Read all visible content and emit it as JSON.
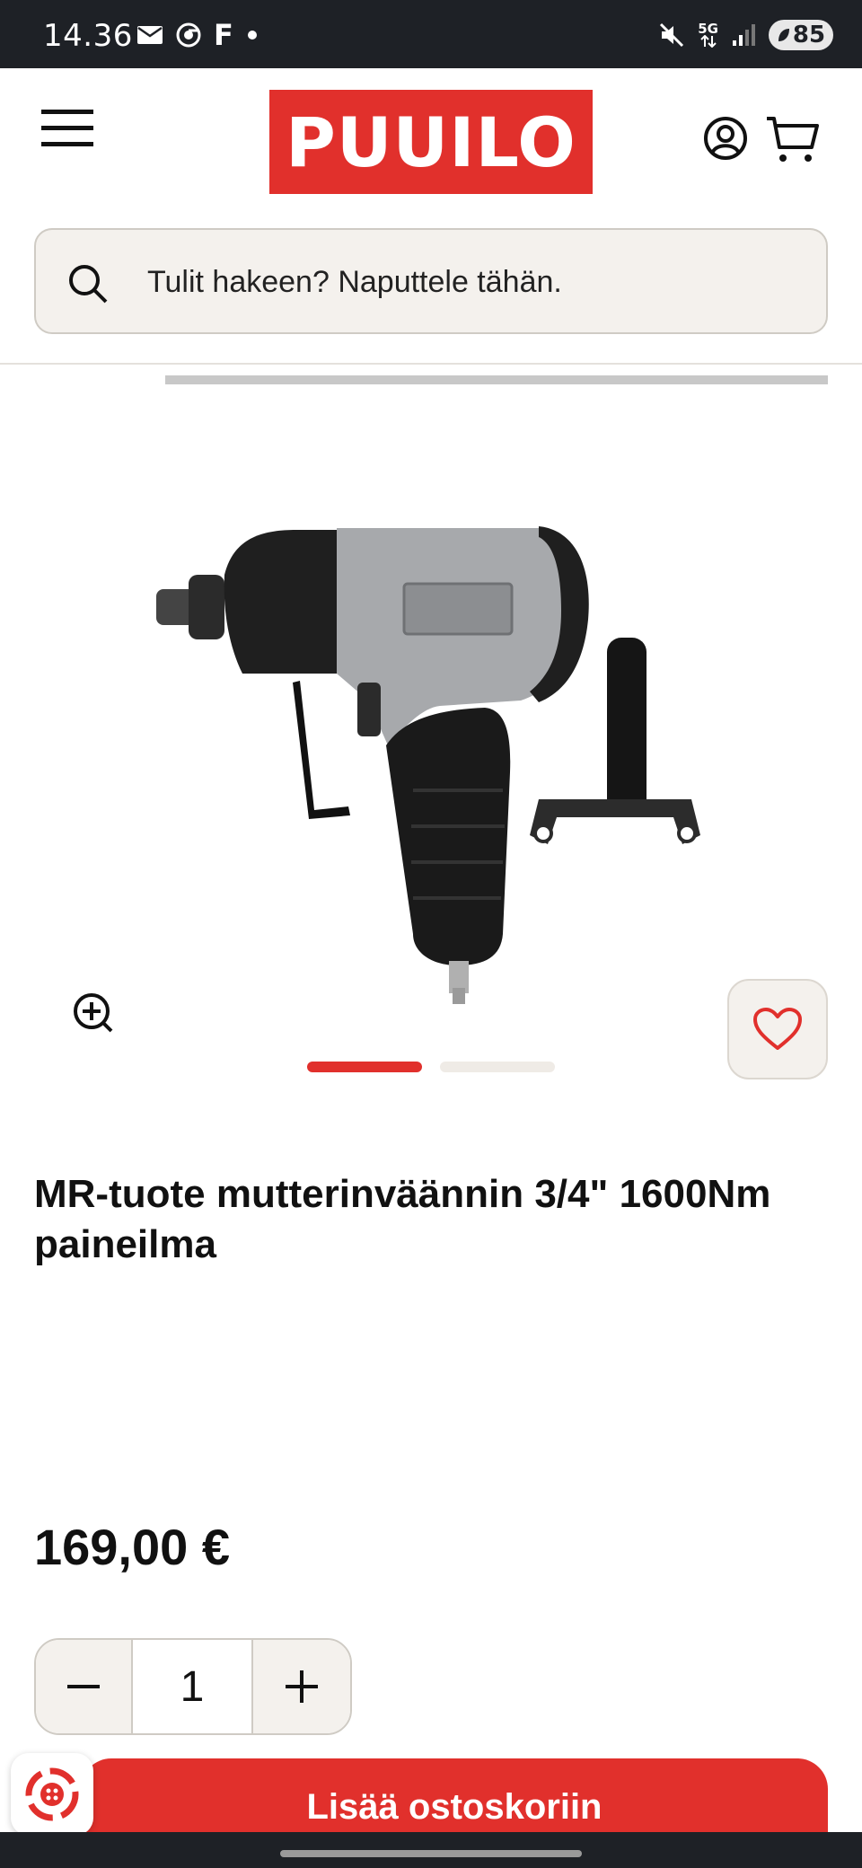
{
  "status_bar": {
    "time": "14.36",
    "left_icons": [
      "mail-icon",
      "chrome-icon",
      "f-icon",
      "dot-icon"
    ],
    "f_glyph": "F",
    "network": "5G",
    "battery": "85",
    "right_icons": [
      "mute-icon",
      "network-5g-icon",
      "signal-icon",
      "battery-icon"
    ]
  },
  "header": {
    "logo_text": "PUUILO",
    "search": {
      "placeholder": "Tulit hakeen? Naputtele tähän."
    }
  },
  "gallery": {
    "image_alt_icon": "impact-wrench-image",
    "slide_count": 2,
    "active_slide": 1
  },
  "product": {
    "title": "MR-tuote mutterinväännin 3/4\" 1600Nm paineilma",
    "price": "169,00 €",
    "quantity": "1",
    "add_to_cart_label": "Lisää ostoskoriin"
  },
  "colors": {
    "brand_red": "#e1302c",
    "status_bar": "#1e2126",
    "beige": "#f4f1ed"
  }
}
